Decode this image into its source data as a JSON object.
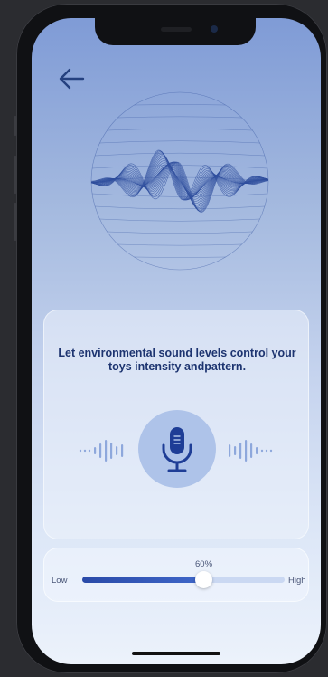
{
  "screen": {
    "description_text": "Let environmental sound levels control your toys intensity andpattern.",
    "back_icon": "arrow-left-icon",
    "mic_icon": "microphone-icon"
  },
  "intensity_slider": {
    "value_label": "60%",
    "value": 0.6,
    "low_label": "Low",
    "high_label": "High"
  },
  "colors": {
    "accent": "#2a4aa8",
    "text_primary": "#1d3470",
    "mic_background": "#aec3e9"
  }
}
